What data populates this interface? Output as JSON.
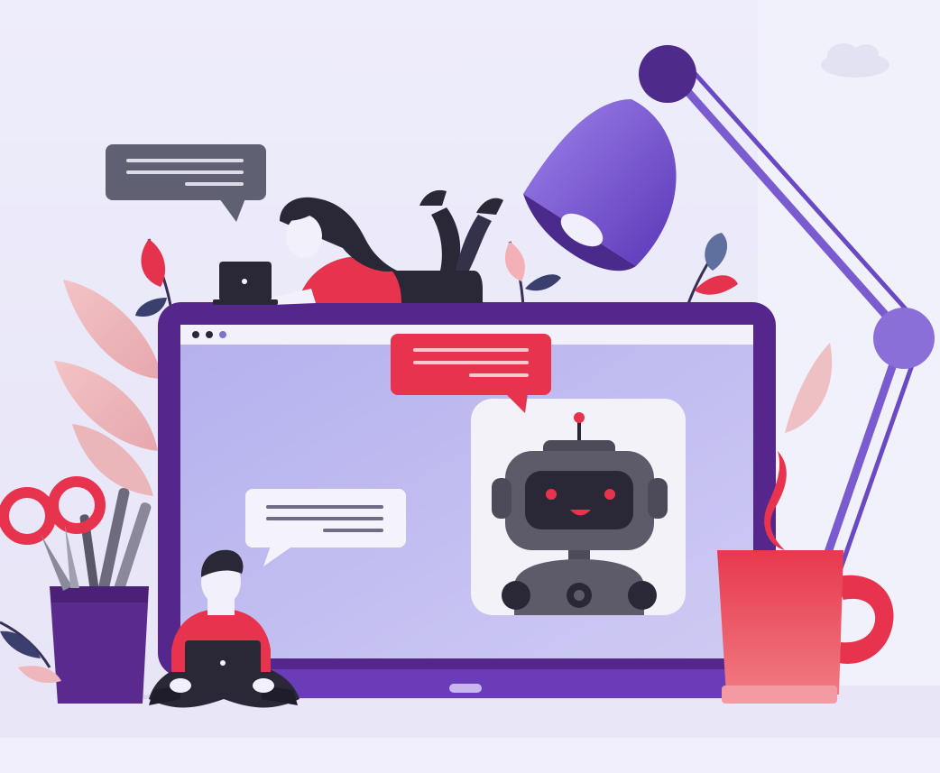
{
  "scene": {
    "description_icons": [
      "laptop-icon",
      "robot-icon",
      "chat-bubble-icon",
      "desk-lamp-icon",
      "mug-icon",
      "scissors-icon",
      "pencil-cup-icon",
      "person-icon",
      "plant-leaf-icon",
      "cloud-icon"
    ],
    "colors": {
      "background": "#ecebf9",
      "laptop_frame": "#5b2c8f",
      "screen": "#b9b6ee",
      "accent_red": "#e8334f",
      "lamp_purple": "#7a5bd0",
      "robot_body": "#5d5b6a",
      "dark": "#2a2836",
      "bubble_gray": "#5f6173"
    }
  }
}
